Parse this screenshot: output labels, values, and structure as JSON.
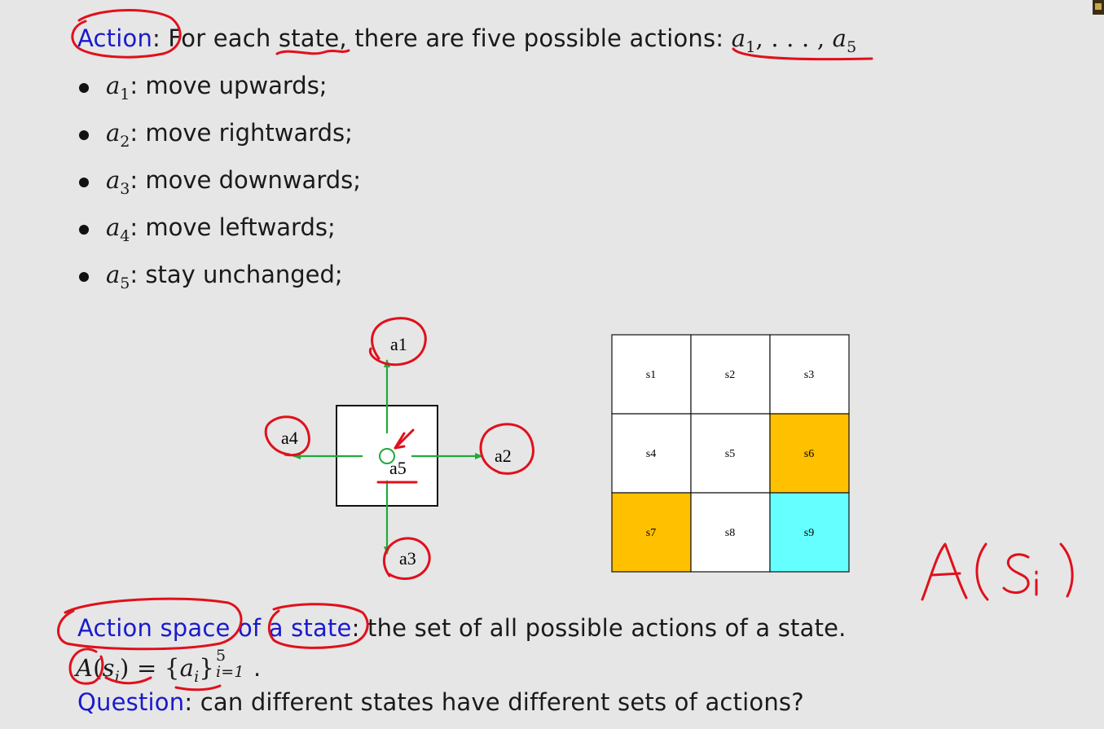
{
  "action_line": {
    "label": "Action",
    "colon": ":",
    "text": " For each state, there are five possible actions: ",
    "math_a": "a",
    "sub_first": "1",
    "math_sep": ", . . . , ",
    "math_a2": "a",
    "sub_last": "5"
  },
  "actions": [
    {
      "symbol": "a",
      "sub": "1",
      "desc": ": move upwards;"
    },
    {
      "symbol": "a",
      "sub": "2",
      "desc": ": move rightwards;"
    },
    {
      "symbol": "a",
      "sub": "3",
      "desc": ": move downwards;"
    },
    {
      "symbol": "a",
      "sub": "4",
      "desc": ": move leftwards;"
    },
    {
      "symbol": "a",
      "sub": "5",
      "desc": ": stay unchanged;"
    }
  ],
  "action_diagram": {
    "labels": {
      "up": "a1",
      "right": "a2",
      "down": "a3",
      "left": "a4",
      "stay": "a5"
    },
    "arrow_color": "#1faa3c"
  },
  "grid": {
    "cells": [
      {
        "label": "s1",
        "color": "#ffffff"
      },
      {
        "label": "s2",
        "color": "#ffffff"
      },
      {
        "label": "s3",
        "color": "#ffffff"
      },
      {
        "label": "s4",
        "color": "#ffffff"
      },
      {
        "label": "s5",
        "color": "#ffffff"
      },
      {
        "label": "s6",
        "color": "#ffc000"
      },
      {
        "label": "s7",
        "color": "#ffc000"
      },
      {
        "label": "s8",
        "color": "#ffffff"
      },
      {
        "label": "s9",
        "color": "#66ffff"
      }
    ]
  },
  "action_space": {
    "label1": "Action space",
    "label2": " of ",
    "label3": "a state",
    "colon": ":",
    "text": " the set of all possible actions of a state."
  },
  "formula": {
    "A": "A",
    "lparen": "(",
    "s": "s",
    "s_sub": "i",
    "rparen": ")",
    "eq": " = {",
    "a": "a",
    "a_sub": "i",
    "rbrace": "}",
    "sup": "5",
    "range": "i=1",
    "dot": "."
  },
  "question": {
    "label": "Question",
    "text": ": can different states have different sets of actions?"
  },
  "handwriting": {
    "note": "A(Si)",
    "ink_color": "#e0101c"
  }
}
